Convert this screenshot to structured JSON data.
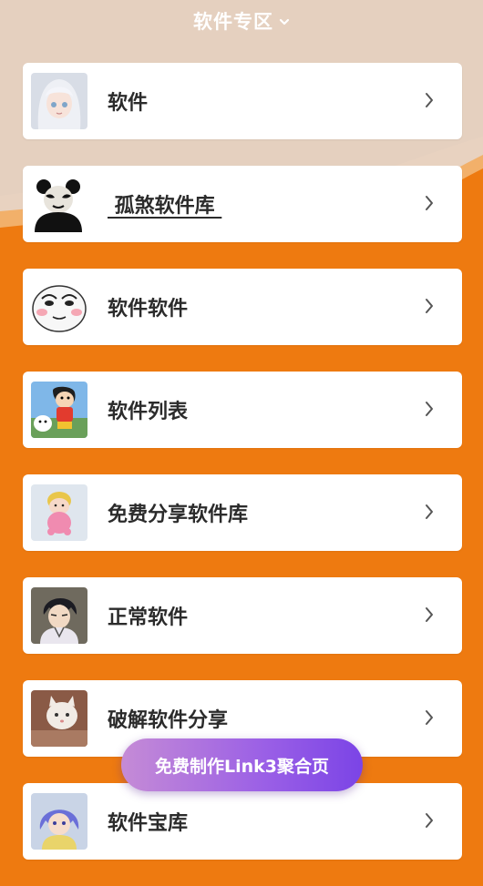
{
  "header": {
    "title": "软件专区",
    "toggle_icon": "chevron-down-icon"
  },
  "colors": {
    "background_orange": "#ee7a10",
    "header_beige": "#e5d0bf",
    "card": "#ffffff",
    "button_gradient": [
      "#c58bd6",
      "#7b44e6"
    ]
  },
  "items": [
    {
      "label": "软件",
      "thumb": "anime-girl-white-hair",
      "underline": false
    },
    {
      "label": " 孤煞软件库 ",
      "thumb": "panda-meme-face",
      "underline": true
    },
    {
      "label": "软件软件",
      "thumb": "smirk-face-meme",
      "underline": false
    },
    {
      "label": "软件列表",
      "thumb": "cartoon-boy-with-dog",
      "underline": false
    },
    {
      "label": "免费分享软件库",
      "thumb": "pink-cartoon-character",
      "underline": false
    },
    {
      "label": "正常软件",
      "thumb": "anime-ninja-boy",
      "underline": false
    },
    {
      "label": "破解软件分享",
      "thumb": "cat-photo",
      "underline": false
    },
    {
      "label": "软件宝库",
      "thumb": "anime-blue-hair-girl",
      "underline": false
    }
  ],
  "cta": {
    "label": "免费制作Link3聚合页"
  }
}
